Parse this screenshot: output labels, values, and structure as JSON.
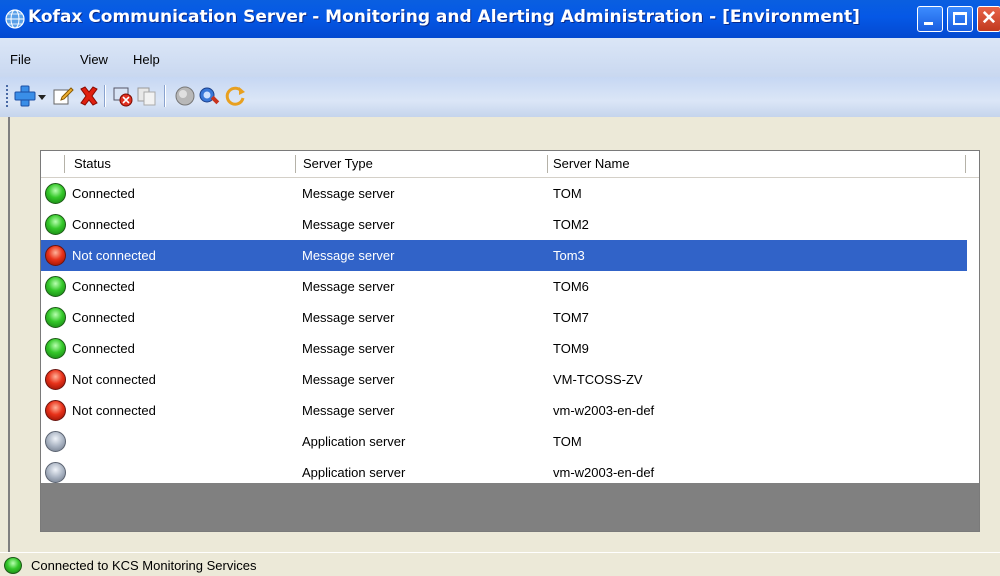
{
  "window": {
    "title": "Kofax Communication Server - Monitoring and Alerting Administration - [Environment]"
  },
  "menu": {
    "items": [
      "File",
      "View",
      "Help"
    ]
  },
  "toolbar": {
    "buttons": [
      {
        "icon": "add-plus-icon"
      },
      {
        "icon": "dropdown-arrow-icon"
      },
      {
        "icon": "edit-icon"
      },
      {
        "icon": "delete-x-icon"
      },
      {
        "icon": "disconnect-icon"
      },
      {
        "icon": "copy-icon"
      },
      {
        "icon": "server-icon"
      },
      {
        "icon": "search-server-icon"
      },
      {
        "icon": "refresh-icon"
      }
    ]
  },
  "table": {
    "columns": [
      "Status",
      "Server Type",
      "Server Name"
    ],
    "rows": [
      {
        "status": "Connected",
        "state": "green",
        "type": "Message server",
        "name": "TOM"
      },
      {
        "status": "Connected",
        "state": "green",
        "type": "Message server",
        "name": "TOM2"
      },
      {
        "status": "Not connected",
        "state": "red",
        "type": "Message server",
        "name": "Tom3",
        "selected": true
      },
      {
        "status": "Connected",
        "state": "green",
        "type": "Message server",
        "name": "TOM6"
      },
      {
        "status": "Connected",
        "state": "green",
        "type": "Message server",
        "name": "TOM7"
      },
      {
        "status": "Connected",
        "state": "green",
        "type": "Message server",
        "name": "TOM9"
      },
      {
        "status": "Not connected",
        "state": "red",
        "type": "Message server",
        "name": "VM-TCOSS-ZV"
      },
      {
        "status": "Not connected",
        "state": "red",
        "type": "Message server",
        "name": "vm-w2003-en-def"
      },
      {
        "status": "",
        "state": "grey",
        "type": "Application server",
        "name": "TOM"
      },
      {
        "status": "",
        "state": "grey",
        "type": "Application server",
        "name": "vm-w2003-en-def"
      }
    ]
  },
  "statusbar": {
    "text": "Connected to KCS Monitoring Services",
    "state": "green"
  },
  "colors": {
    "selection": "#3163c8",
    "titlebar": "#0558e6",
    "connected": "#35c82a",
    "disconnected": "#e8321a"
  }
}
